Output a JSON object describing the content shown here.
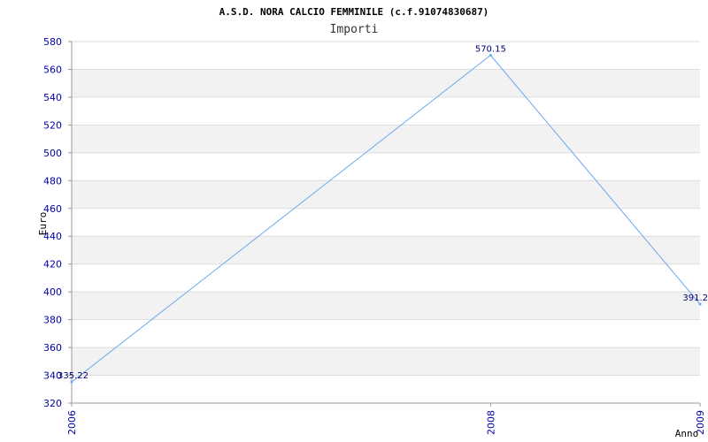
{
  "chart_data": {
    "type": "line",
    "title": "A.S.D. NORA CALCIO FEMMINILE (c.f.91074830687)",
    "subtitle": "Importi",
    "xlabel": "Anno",
    "ylabel": "Euro",
    "x": [
      "2006",
      "2008",
      "2009"
    ],
    "series": [
      {
        "values": [
          335.22,
          570.15,
          391.2
        ],
        "labels": [
          "335.22",
          "570.15",
          "391.2"
        ]
      }
    ],
    "ylim": [
      320,
      580
    ],
    "yticks": [
      "320",
      "340",
      "360",
      "380",
      "400",
      "420",
      "440",
      "460",
      "480",
      "500",
      "520",
      "540",
      "560",
      "580"
    ],
    "grid": "horizontal bands",
    "colors": {
      "line": "#6aa9f0",
      "band": "#f2f2f2",
      "gridline": "#dddddd",
      "axis": "#999999",
      "tick_text": "#0000aa",
      "data_label": "#000077"
    }
  }
}
